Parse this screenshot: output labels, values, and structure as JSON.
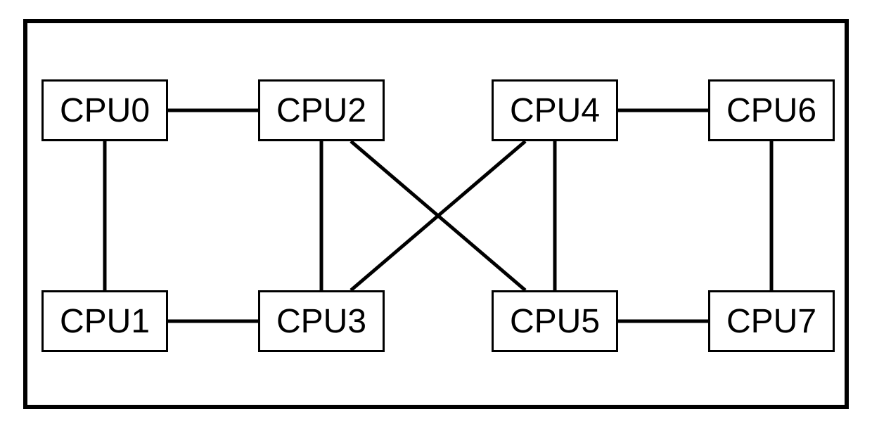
{
  "diagram": {
    "nodes": {
      "cpu0": "CPU0",
      "cpu1": "CPU1",
      "cpu2": "CPU2",
      "cpu3": "CPU3",
      "cpu4": "CPU4",
      "cpu5": "CPU5",
      "cpu6": "CPU6",
      "cpu7": "CPU7"
    },
    "edges": [
      [
        "cpu0",
        "cpu2"
      ],
      [
        "cpu2",
        "cpu3"
      ],
      [
        "cpu2",
        "cpu5"
      ],
      [
        "cpu4",
        "cpu3"
      ],
      [
        "cpu4",
        "cpu5"
      ],
      [
        "cpu4",
        "cpu6"
      ],
      [
        "cpu0",
        "cpu1"
      ],
      [
        "cpu1",
        "cpu3"
      ],
      [
        "cpu5",
        "cpu7"
      ],
      [
        "cpu6",
        "cpu7"
      ]
    ],
    "node_positions": {
      "cpu0": {
        "row": 0,
        "col": 0
      },
      "cpu2": {
        "row": 0,
        "col": 1
      },
      "cpu4": {
        "row": 0,
        "col": 2
      },
      "cpu6": {
        "row": 0,
        "col": 3
      },
      "cpu1": {
        "row": 1,
        "col": 0
      },
      "cpu3": {
        "row": 1,
        "col": 1
      },
      "cpu5": {
        "row": 1,
        "col": 2
      },
      "cpu7": {
        "row": 1,
        "col": 3
      }
    }
  }
}
